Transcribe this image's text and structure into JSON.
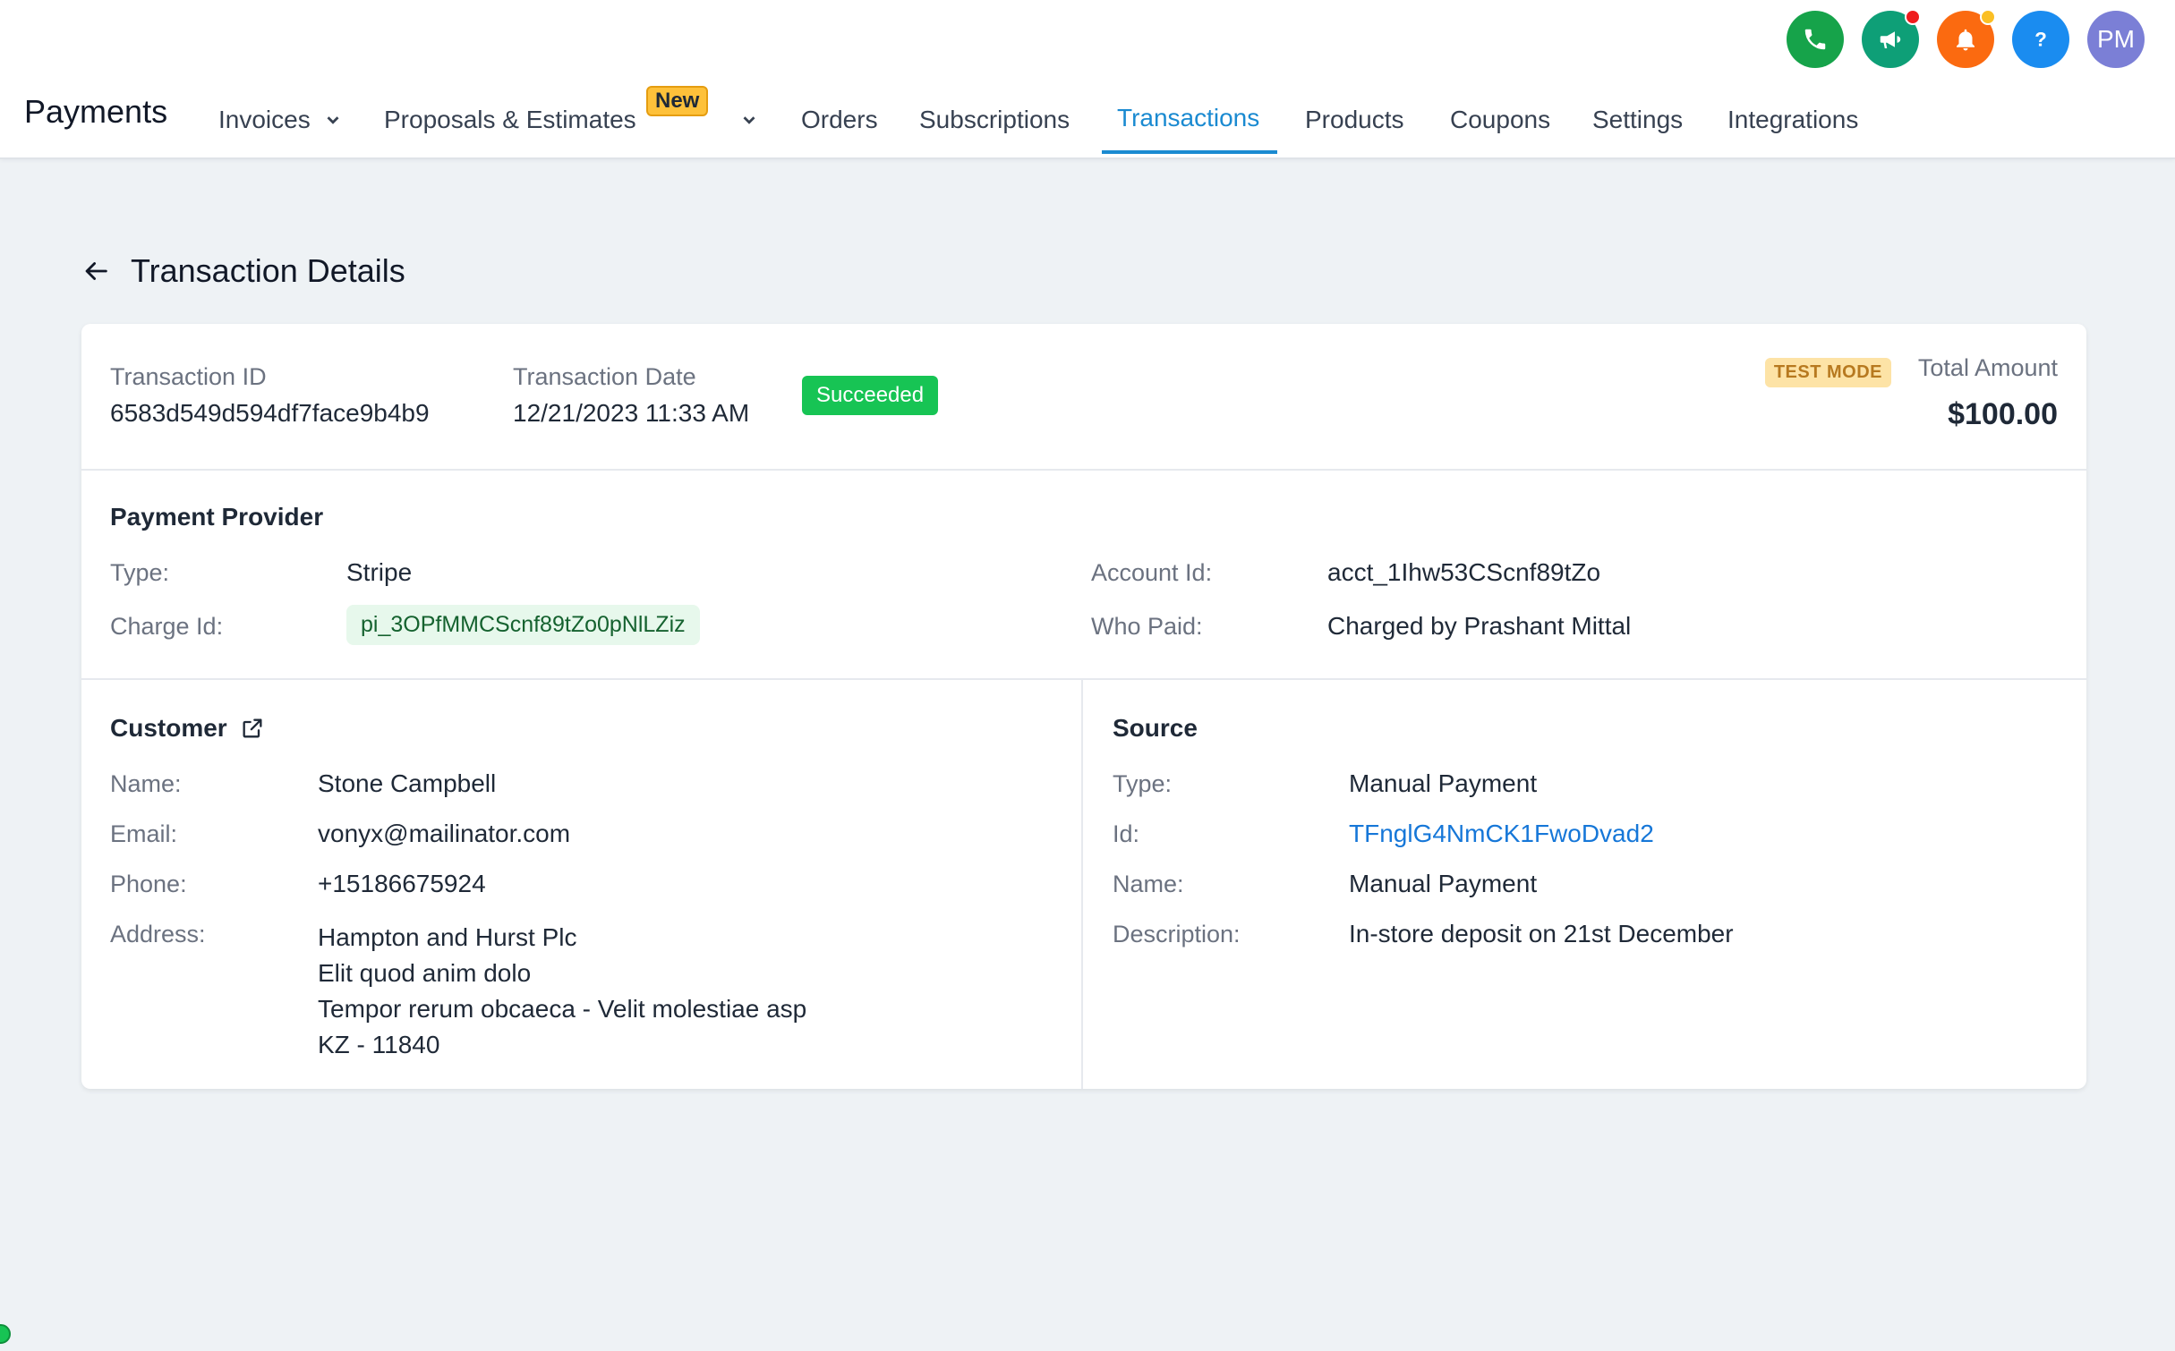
{
  "header": {
    "brand": "Payments",
    "nav": [
      {
        "label": "Invoices"
      },
      {
        "label": "Proposals & Estimates",
        "badge": "New"
      },
      {
        "label": "Orders"
      },
      {
        "label": "Subscriptions"
      },
      {
        "label": "Transactions",
        "active": true
      },
      {
        "label": "Products"
      },
      {
        "label": "Coupons"
      },
      {
        "label": "Settings"
      },
      {
        "label": "Integrations"
      }
    ],
    "icons": [
      {
        "name": "phone-icon",
        "color": "#16a34a"
      },
      {
        "name": "megaphone-icon",
        "color": "#0e9f77",
        "dot": "#ef1d1d"
      },
      {
        "name": "bell-icon",
        "color": "#fb6a10",
        "dot": "#fbbf24"
      },
      {
        "name": "help-icon",
        "color": "#1a8cf0"
      },
      {
        "name": "avatar",
        "initials": "PM",
        "color": "#7b7fd6"
      }
    ]
  },
  "page": {
    "title": "Transaction Details"
  },
  "summary": {
    "transaction_id_label": "Transaction ID",
    "transaction_id": "6583d549d594df7face9b4b9",
    "transaction_date_label": "Transaction Date",
    "transaction_date": "12/21/2023 11:33 AM",
    "status": "Succeeded",
    "test_mode": "TEST MODE",
    "total_label": "Total Amount",
    "total": "$100.00"
  },
  "provider": {
    "title": "Payment Provider",
    "type_label": "Type:",
    "type": "Stripe",
    "charge_label": "Charge Id:",
    "charge_id": "pi_3OPfMMCScnf89tZo0pNlLZiz",
    "account_label": "Account Id:",
    "account_id": "acct_1Ihw53CScnf89tZo",
    "who_label": "Who Paid:",
    "who_paid": "Charged by Prashant Mittal"
  },
  "customer": {
    "title": "Customer",
    "name_label": "Name:",
    "name": "Stone Campbell",
    "email_label": "Email:",
    "email": "vonyx@mailinator.com",
    "phone_label": "Phone:",
    "phone": "+15186675924",
    "address_label": "Address:",
    "address_lines": [
      "Hampton and Hurst Plc",
      "Elit quod anim dolo",
      "Tempor rerum obcaeca - Velit molestiae asp",
      "KZ - 11840"
    ]
  },
  "source": {
    "title": "Source",
    "type_label": "Type:",
    "type": "Manual Payment",
    "id_label": "Id:",
    "id": "TFnglG4NmCK1FwoDvad2",
    "name_label": "Name:",
    "name": "Manual Payment",
    "desc_label": "Description:",
    "description": "In-store deposit on 21st December"
  }
}
